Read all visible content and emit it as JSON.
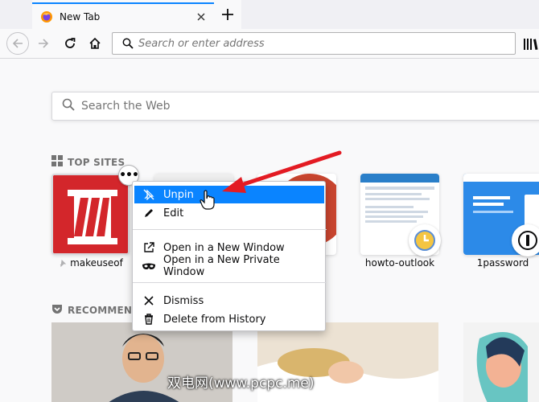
{
  "browser": {
    "tab_title": "New Tab",
    "url_placeholder": "Search or enter address"
  },
  "page": {
    "search_placeholder": "Search the Web",
    "top_sites_title": "TOP SITES",
    "recommended_title": "RECOMMENDED BY POCKET",
    "recommended_visible": "RECOMMEND"
  },
  "top_sites": [
    {
      "label": "makeuseof",
      "pinned": true
    },
    {
      "label": ""
    },
    {
      "label": ""
    },
    {
      "label": "howto-outlook"
    },
    {
      "label": "1password"
    }
  ],
  "context_menu": {
    "items": [
      {
        "label": "Unpin",
        "icon": "unpin-icon",
        "active": true
      },
      {
        "label": "Edit",
        "icon": "pencil-icon"
      },
      {
        "label": "Open in a New Window",
        "icon": "new-window-icon"
      },
      {
        "label": "Open in a New Private Window",
        "icon": "private-mask-icon"
      },
      {
        "label": "Dismiss",
        "icon": "close-icon"
      },
      {
        "label": "Delete from History",
        "icon": "trash-icon"
      }
    ]
  },
  "ellipsis_label": "•••",
  "watermark": "双电网(www.pcpc.me)",
  "colors": {
    "accent": "#0a84ff",
    "annotation_arrow": "#e31b23",
    "makeuseof_red": "#d3262b"
  }
}
